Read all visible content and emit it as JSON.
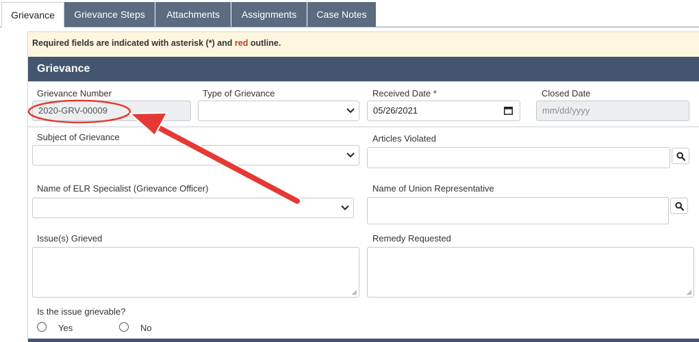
{
  "tabs": [
    {
      "label": "Grievance",
      "active": true
    },
    {
      "label": "Grievance Steps",
      "active": false
    },
    {
      "label": "Attachments",
      "active": false
    },
    {
      "label": "Assignments",
      "active": false
    },
    {
      "label": "Case Notes",
      "active": false
    }
  ],
  "notice": {
    "prefix": "Required fields are indicated with asterisk (*) and ",
    "red_word": "red",
    "suffix": " outline."
  },
  "section": {
    "title": "Grievance"
  },
  "fields": {
    "grievance_number": {
      "label": "Grievance Number",
      "value": "2020-GRV-00009"
    },
    "type_of_grievance": {
      "label": "Type of Grievance",
      "value": ""
    },
    "received_date": {
      "label": "Received Date *",
      "value": "05/26/2021"
    },
    "closed_date": {
      "label": "Closed Date",
      "placeholder": "mm/dd/yyyy"
    },
    "subject_of_grievance": {
      "label": "Subject of Grievance",
      "value": ""
    },
    "articles_violated": {
      "label": "Articles Violated",
      "value": ""
    },
    "elr_specialist": {
      "label": "Name of ELR Specialist (Grievance Officer)",
      "value": ""
    },
    "union_representative": {
      "label": "Name of Union Representative",
      "value": ""
    },
    "issues_grieved": {
      "label": "Issue(s) Grieved",
      "value": ""
    },
    "remedy_requested": {
      "label": "Remedy Requested",
      "value": ""
    }
  },
  "grievable": {
    "question": "Is the issue grievable?",
    "options": [
      "Yes",
      "No"
    ]
  },
  "colors": {
    "header_bg": "#44566f",
    "tab_bg": "#5b6b80",
    "notice_bg": "#fff6e0",
    "annotation_red": "#e53935"
  },
  "icons": [
    "chevron-down-icon",
    "calendar-icon",
    "search-icon",
    "annotation-arrow"
  ]
}
